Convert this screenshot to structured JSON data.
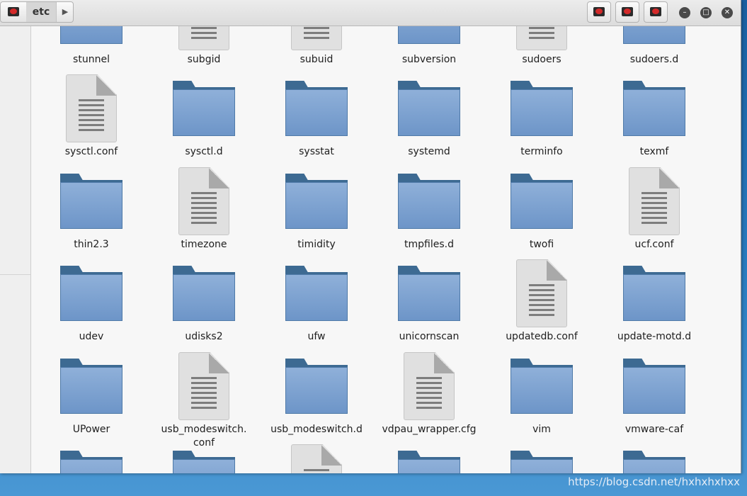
{
  "header": {
    "path_current": "etc",
    "path_next_icon": "chevron-right-icon",
    "minimize_icon": "minimize-icon",
    "maximize_icon": "maximize-icon",
    "close_icon": "close-icon"
  },
  "files": [
    {
      "name": "stunnel",
      "kind": "folder"
    },
    {
      "name": "subgid",
      "kind": "file"
    },
    {
      "name": "subuid",
      "kind": "file"
    },
    {
      "name": "subversion",
      "kind": "folder"
    },
    {
      "name": "sudoers",
      "kind": "file"
    },
    {
      "name": "sudoers.d",
      "kind": "folder"
    },
    {
      "name": "sysctl.conf",
      "kind": "file"
    },
    {
      "name": "sysctl.d",
      "kind": "folder"
    },
    {
      "name": "sysstat",
      "kind": "folder"
    },
    {
      "name": "systemd",
      "kind": "folder"
    },
    {
      "name": "terminfo",
      "kind": "folder"
    },
    {
      "name": "texmf",
      "kind": "folder"
    },
    {
      "name": "thin2.3",
      "kind": "folder"
    },
    {
      "name": "timezone",
      "kind": "file"
    },
    {
      "name": "timidity",
      "kind": "folder"
    },
    {
      "name": "tmpfiles.d",
      "kind": "folder"
    },
    {
      "name": "twofi",
      "kind": "folder"
    },
    {
      "name": "ucf.conf",
      "kind": "file"
    },
    {
      "name": "udev",
      "kind": "folder"
    },
    {
      "name": "udisks2",
      "kind": "folder"
    },
    {
      "name": "ufw",
      "kind": "folder"
    },
    {
      "name": "unicornscan",
      "kind": "folder"
    },
    {
      "name": "updatedb.conf",
      "kind": "file"
    },
    {
      "name": "update-motd.d",
      "kind": "folder"
    },
    {
      "name": "UPower",
      "kind": "folder"
    },
    {
      "name": "usb_modeswitch.\nconf",
      "kind": "file"
    },
    {
      "name": "usb_modeswitch.d",
      "kind": "folder"
    },
    {
      "name": "vdpau_wrapper.cfg",
      "kind": "file"
    },
    {
      "name": "vim",
      "kind": "folder"
    },
    {
      "name": "vmware-caf",
      "kind": "folder"
    },
    {
      "name": "",
      "kind": "folder"
    },
    {
      "name": "",
      "kind": "folder"
    },
    {
      "name": "",
      "kind": "file"
    },
    {
      "name": "",
      "kind": "folder"
    },
    {
      "name": "",
      "kind": "folder"
    },
    {
      "name": "",
      "kind": "folder"
    }
  ],
  "watermark": "https://blog.csdn.net/hxhxhxhxx"
}
